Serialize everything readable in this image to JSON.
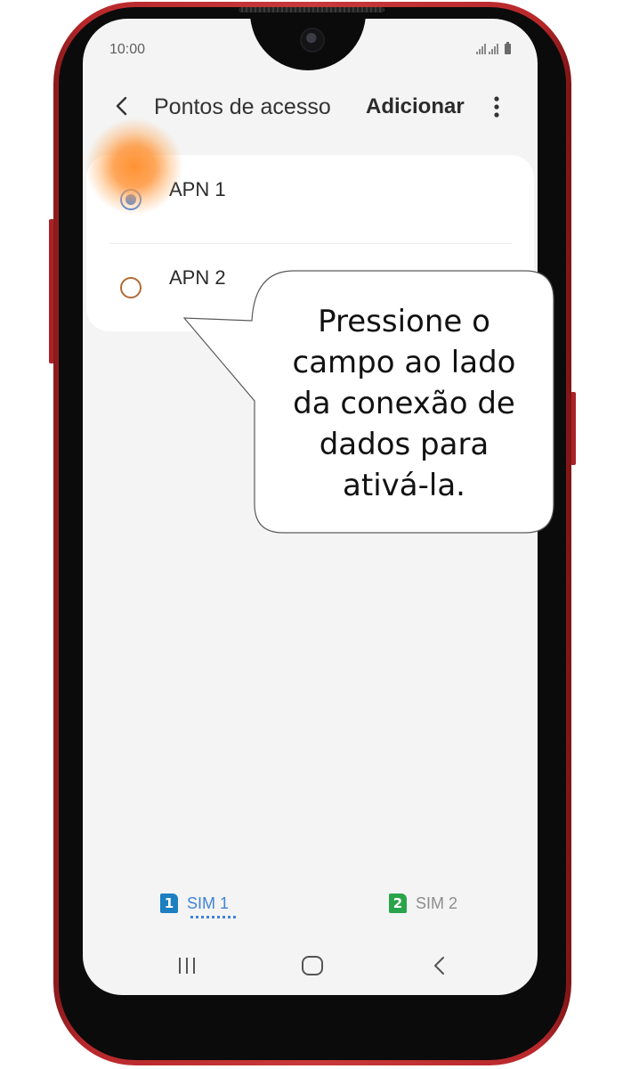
{
  "status_bar": {
    "time": "10:00"
  },
  "header": {
    "back_icon": "chevron-left-icon",
    "title": "Pontos de acesso",
    "add_label": "Adicionar",
    "more_icon": "more-vert-icon"
  },
  "apn_list": [
    {
      "label": "APN 1",
      "selected": true
    },
    {
      "label": "APN 2",
      "selected": false
    }
  ],
  "sim_tabs": [
    {
      "badge": "1",
      "label": "SIM 1",
      "active": true,
      "color": "#1b7fc1"
    },
    {
      "badge": "2",
      "label": "SIM 2",
      "active": false,
      "color": "#2aa44a"
    }
  ],
  "nav_bar": {
    "recent_icon": "recent-apps-icon",
    "home_icon": "home-icon",
    "back_icon": "back-icon"
  },
  "callout": {
    "text": "Pressione o\ncampo ao lado\nda conexão de\ndados para\n ativá-la."
  },
  "colors": {
    "accent": "#3e84e6",
    "highlight": "#ff8c28",
    "phone_body": "#c9393b"
  }
}
